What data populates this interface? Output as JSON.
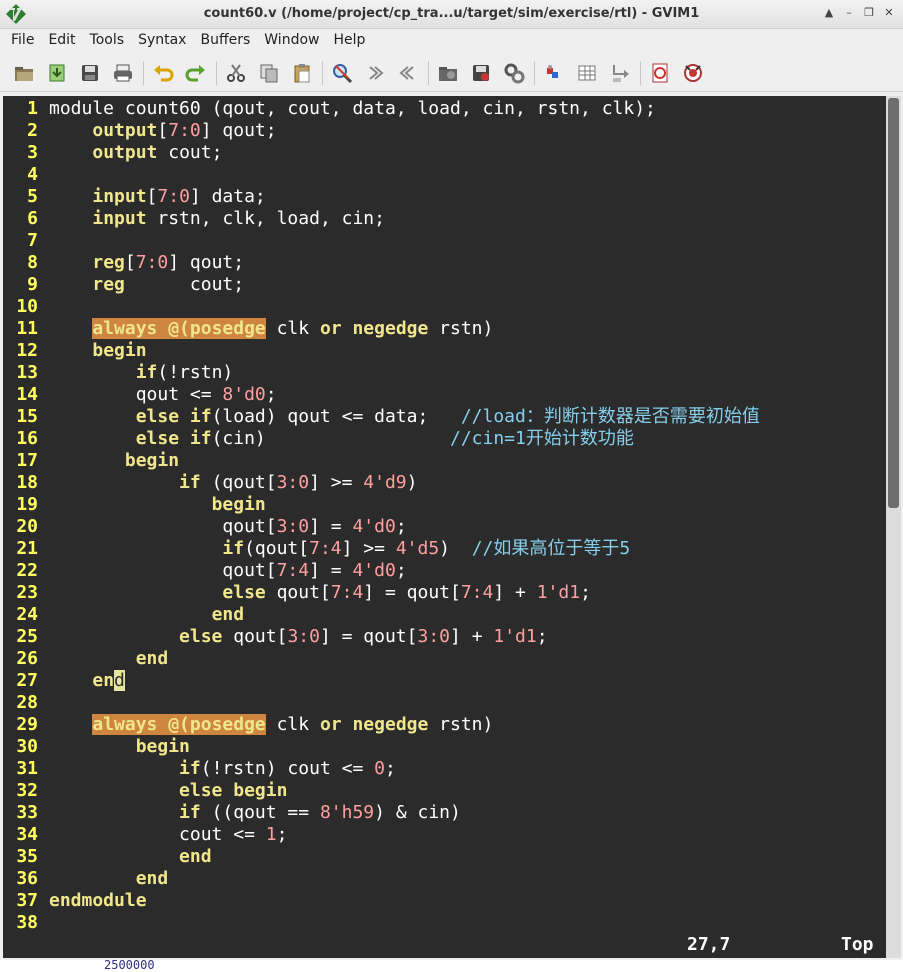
{
  "window": {
    "title": "count60.v (/home/project/cp_tra...u/target/sim/exercise/rtl) - GVIM1",
    "controls": [
      "▲",
      "–",
      "❐",
      "✕"
    ]
  },
  "menu": [
    "File",
    "Edit",
    "Tools",
    "Syntax",
    "Buffers",
    "Window",
    "Help"
  ],
  "toolbar": [
    {
      "name": "open-icon"
    },
    {
      "name": "save-session-icon"
    },
    {
      "name": "save-icon"
    },
    {
      "name": "print-icon"
    },
    {
      "sep": true
    },
    {
      "name": "undo-icon"
    },
    {
      "name": "redo-icon"
    },
    {
      "sep": true
    },
    {
      "name": "cut-icon"
    },
    {
      "name": "copy-icon"
    },
    {
      "name": "paste-icon"
    },
    {
      "sep": true
    },
    {
      "name": "find-replace-icon"
    },
    {
      "name": "find-next-icon"
    },
    {
      "name": "find-prev-icon"
    },
    {
      "sep": true
    },
    {
      "name": "load-session-icon"
    },
    {
      "name": "save-session-2-icon"
    },
    {
      "name": "run-script-icon"
    },
    {
      "sep": true
    },
    {
      "name": "make-icon"
    },
    {
      "name": "shell-icon"
    },
    {
      "name": "ctags-jump-icon"
    },
    {
      "sep": true
    },
    {
      "name": "help-icon"
    },
    {
      "name": "find-help-icon"
    }
  ],
  "colors": {
    "background": "#2b2b2b",
    "line_number": "#ffff60",
    "keyword": "#f0e68c",
    "always_highlight": "#cd853f",
    "number": "#ffa0a0",
    "comment": "#87ceeb"
  },
  "lines": [
    [
      {
        "t": "module",
        "c": "plain"
      },
      {
        "t": " count60 (qout, cout, data, load, cin, rstn, clk);",
        "c": "plain"
      }
    ],
    [
      {
        "t": "    "
      },
      {
        "t": "output",
        "c": "kw"
      },
      {
        "t": "[",
        "c": "plain"
      },
      {
        "t": "7:0",
        "c": "num"
      },
      {
        "t": "] qout;"
      }
    ],
    [
      {
        "t": "    "
      },
      {
        "t": "output",
        "c": "kw"
      },
      {
        "t": " cout;"
      }
    ],
    [],
    [
      {
        "t": "    "
      },
      {
        "t": "input",
        "c": "kw"
      },
      {
        "t": "["
      },
      {
        "t": "7:0",
        "c": "num"
      },
      {
        "t": "] data;"
      }
    ],
    [
      {
        "t": "    "
      },
      {
        "t": "input",
        "c": "kw"
      },
      {
        "t": " rstn, clk, load, cin;"
      }
    ],
    [],
    [
      {
        "t": "    "
      },
      {
        "t": "reg",
        "c": "kw"
      },
      {
        "t": "["
      },
      {
        "t": "7:0",
        "c": "num"
      },
      {
        "t": "] qout;"
      }
    ],
    [
      {
        "t": "    "
      },
      {
        "t": "reg",
        "c": "kw"
      },
      {
        "t": "      cout;"
      }
    ],
    [],
    [
      {
        "t": "    "
      },
      {
        "t": "always @(posedge",
        "c": "hl"
      },
      {
        "t": " clk "
      },
      {
        "t": "or",
        "c": "kw"
      },
      {
        "t": " "
      },
      {
        "t": "negedge",
        "c": "kw"
      },
      {
        "t": " rstn)"
      }
    ],
    [
      {
        "t": "    "
      },
      {
        "t": "begin",
        "c": "kw"
      }
    ],
    [
      {
        "t": "        "
      },
      {
        "t": "if",
        "c": "kw"
      },
      {
        "t": "(!rstn)"
      }
    ],
    [
      {
        "t": "        qout <= "
      },
      {
        "t": "8'd0",
        "c": "num"
      },
      {
        "t": ";"
      }
    ],
    [
      {
        "t": "        "
      },
      {
        "t": "else if",
        "c": "kw"
      },
      {
        "t": "(load) qout <= data;   "
      },
      {
        "t": "//load：判断计数器是否需要初始值",
        "c": "cmt"
      }
    ],
    [
      {
        "t": "        "
      },
      {
        "t": "else if",
        "c": "kw"
      },
      {
        "t": "(cin)                 "
      },
      {
        "t": "//cin=1开始计数功能",
        "c": "cmt"
      }
    ],
    [
      {
        "t": "       "
      },
      {
        "t": "begin",
        "c": "kw"
      }
    ],
    [
      {
        "t": "            "
      },
      {
        "t": "if",
        "c": "kw"
      },
      {
        "t": " (qout["
      },
      {
        "t": "3:0",
        "c": "num"
      },
      {
        "t": "] >= "
      },
      {
        "t": "4'd9",
        "c": "num"
      },
      {
        "t": ")"
      }
    ],
    [
      {
        "t": "               "
      },
      {
        "t": "begin",
        "c": "kw"
      }
    ],
    [
      {
        "t": "                qout["
      },
      {
        "t": "3:0",
        "c": "num"
      },
      {
        "t": "] = "
      },
      {
        "t": "4'd0",
        "c": "num"
      },
      {
        "t": ";"
      }
    ],
    [
      {
        "t": "                "
      },
      {
        "t": "if",
        "c": "kw"
      },
      {
        "t": "(qout["
      },
      {
        "t": "7:4",
        "c": "num"
      },
      {
        "t": "] >= "
      },
      {
        "t": "4'd5",
        "c": "num"
      },
      {
        "t": ")  "
      },
      {
        "t": "//如果高位于等于5",
        "c": "cmt"
      }
    ],
    [
      {
        "t": "                qout["
      },
      {
        "t": "7:4",
        "c": "num"
      },
      {
        "t": "] = "
      },
      {
        "t": "4'd0",
        "c": "num"
      },
      {
        "t": ";"
      }
    ],
    [
      {
        "t": "                "
      },
      {
        "t": "else",
        "c": "kw"
      },
      {
        "t": " qout["
      },
      {
        "t": "7:4",
        "c": "num"
      },
      {
        "t": "] = qout["
      },
      {
        "t": "7:4",
        "c": "num"
      },
      {
        "t": "] + "
      },
      {
        "t": "1'd1",
        "c": "num"
      },
      {
        "t": ";"
      }
    ],
    [
      {
        "t": "               "
      },
      {
        "t": "end",
        "c": "kw"
      }
    ],
    [
      {
        "t": "            "
      },
      {
        "t": "else",
        "c": "kw"
      },
      {
        "t": " qout["
      },
      {
        "t": "3:0",
        "c": "num"
      },
      {
        "t": "] = qout["
      },
      {
        "t": "3:0",
        "c": "num"
      },
      {
        "t": "] + "
      },
      {
        "t": "1'd1",
        "c": "num"
      },
      {
        "t": ";"
      }
    ],
    [
      {
        "t": "        "
      },
      {
        "t": "end",
        "c": "kw"
      }
    ],
    [
      {
        "t": "    "
      },
      {
        "t": "en",
        "c": "kw"
      },
      {
        "t": "d",
        "c": "cursor"
      }
    ],
    [],
    [
      {
        "t": "    "
      },
      {
        "t": "always @(posedge",
        "c": "hl"
      },
      {
        "t": " clk "
      },
      {
        "t": "or",
        "c": "kw"
      },
      {
        "t": " "
      },
      {
        "t": "negedge",
        "c": "kw"
      },
      {
        "t": " rstn)"
      }
    ],
    [
      {
        "t": "        "
      },
      {
        "t": "begin",
        "c": "kw"
      }
    ],
    [
      {
        "t": "            "
      },
      {
        "t": "if",
        "c": "kw"
      },
      {
        "t": "(!rstn) cout <= "
      },
      {
        "t": "0",
        "c": "num"
      },
      {
        "t": ";"
      }
    ],
    [
      {
        "t": "            "
      },
      {
        "t": "else begin",
        "c": "kw"
      }
    ],
    [
      {
        "t": "            "
      },
      {
        "t": "if",
        "c": "kw"
      },
      {
        "t": " ((qout == "
      },
      {
        "t": "8'h59",
        "c": "num"
      },
      {
        "t": ") & cin)"
      }
    ],
    [
      {
        "t": "            cout <= "
      },
      {
        "t": "1",
        "c": "num"
      },
      {
        "t": ";"
      }
    ],
    [
      {
        "t": "            "
      },
      {
        "t": "end",
        "c": "kw"
      }
    ],
    [
      {
        "t": "        "
      },
      {
        "t": "end",
        "c": "kw"
      }
    ],
    [
      {
        "t": "endmodule",
        "c": "kw"
      }
    ],
    []
  ],
  "status": {
    "position": "27,7",
    "scroll": "Top"
  },
  "below_text": "2500000"
}
